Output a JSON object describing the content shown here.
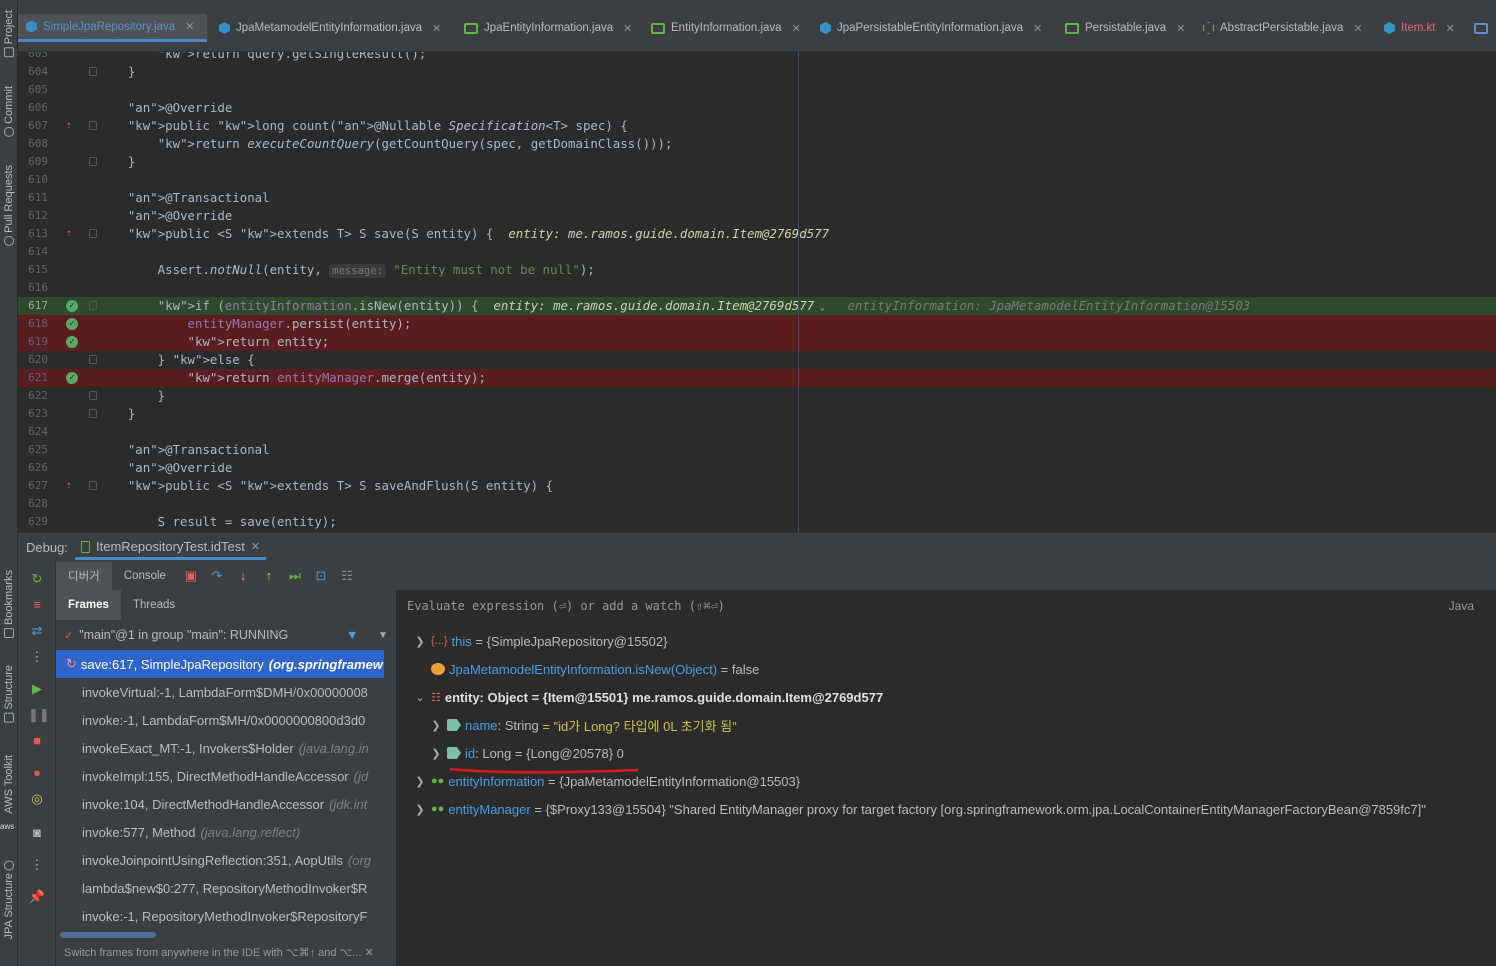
{
  "sidebar_left": {
    "top_items": [
      "Project",
      "Commit",
      "Pull Requests"
    ],
    "bottom_items": [
      "Bookmarks",
      "Structure",
      "AWS Toolkit",
      "JPA Structure"
    ],
    "aws_label": "aws"
  },
  "tabs": [
    {
      "label": "SimpleJpaRepository.java",
      "icon": "java-class-icon",
      "active": true
    },
    {
      "label": "JpaMetamodelEntityInformation.java",
      "icon": "java-class-icon"
    },
    {
      "label": "JpaEntityInformation.java",
      "icon": "interface-icon"
    },
    {
      "label": "EntityInformation.java",
      "icon": "interface-icon"
    },
    {
      "label": "JpaPersistableEntityInformation.java",
      "icon": "java-class-icon"
    },
    {
      "label": "Persistable.java",
      "icon": "interface-icon"
    },
    {
      "label": "AbstractPersistable.java",
      "icon": "abstract-class-icon"
    },
    {
      "label": "Item.kt",
      "icon": "kotlin-class-icon",
      "color": "#e06c6c"
    }
  ],
  "editor": {
    "lines": [
      {
        "n": "603",
        "code": "        return query.getSingleResult();"
      },
      {
        "n": "604",
        "code": "    }"
      },
      {
        "n": "605",
        "code": ""
      },
      {
        "n": "606",
        "code": "    @Override"
      },
      {
        "n": "607",
        "code": "    public long count(@Nullable Specification<T> spec) {"
      },
      {
        "n": "608",
        "code": "        return executeCountQuery(getCountQuery(spec, getDomainClass()));"
      },
      {
        "n": "609",
        "code": "    }"
      },
      {
        "n": "610",
        "code": ""
      },
      {
        "n": "611",
        "code": "    @Transactional"
      },
      {
        "n": "612",
        "code": "    @Override"
      },
      {
        "n": "613",
        "code": "    public <S extends T> S save(S entity) {",
        "inline": "entity: me.ramos.guide.domain.Item@2769d577"
      },
      {
        "n": "614",
        "code": ""
      },
      {
        "n": "615",
        "code": "        Assert.notNull(entity,",
        "hint": "message:",
        "rest": "\"Entity must not be null\");"
      },
      {
        "n": "616",
        "code": ""
      },
      {
        "n": "617",
        "code": "        if (entityInformation.isNew(entity)) {",
        "inline": "entity: me.ramos.guide.domain.Item@2769d577",
        "inline2": "entityInformation: JpaMetamodelEntityInformation@15503",
        "highlight": "green"
      },
      {
        "n": "618",
        "code": "            entityManager.persist(entity);",
        "highlight": "red"
      },
      {
        "n": "619",
        "code": "            return entity;",
        "highlight": "red"
      },
      {
        "n": "620",
        "code": "        } else {"
      },
      {
        "n": "621",
        "code": "            return entityManager.merge(entity);",
        "highlight": "red"
      },
      {
        "n": "622",
        "code": "        }"
      },
      {
        "n": "623",
        "code": "    }"
      },
      {
        "n": "624",
        "code": ""
      },
      {
        "n": "625",
        "code": "    @Transactional"
      },
      {
        "n": "626",
        "code": "    @Override"
      },
      {
        "n": "627",
        "code": "    public <S extends T> S saveAndFlush(S entity) {"
      },
      {
        "n": "628",
        "code": ""
      },
      {
        "n": "629",
        "code": "        S result = save(entity);"
      }
    ]
  },
  "debug": {
    "label": "Debug:",
    "session": "ItemRepositoryTest.idTest",
    "tab_debugger": "디버거",
    "tab_console": "Console",
    "subtab_frames": "Frames",
    "subtab_threads": "Threads",
    "thread": "\"main\"@1 in group \"main\": RUNNING",
    "frames": [
      {
        "method": "save:617, SimpleJpaRepository",
        "pkg": "(org.springframew",
        "selected": true
      },
      {
        "method": "invokeVirtual:-1, LambdaForm$DMH/0x00000008",
        "pkg": ""
      },
      {
        "method": "invoke:-1, LambdaForm$MH/0x0000000800d3d0",
        "pkg": ""
      },
      {
        "method": "invokeExact_MT:-1, Invokers$Holder",
        "pkg": "(java.lang.in"
      },
      {
        "method": "invokeImpl:155, DirectMethodHandleAccessor",
        "pkg": "(jd"
      },
      {
        "method": "invoke:104, DirectMethodHandleAccessor",
        "pkg": "(jdk.int"
      },
      {
        "method": "invoke:577, Method",
        "pkg": "(java.lang.reflect)"
      },
      {
        "method": "invokeJoinpointUsingReflection:351, AopUtils",
        "pkg": "(org"
      },
      {
        "method": "lambda$new$0:277, RepositoryMethodInvoker$R",
        "pkg": ""
      },
      {
        "method": "invoke:-1, RepositoryMethodInvoker$RepositoryF",
        "pkg": ""
      }
    ],
    "tip": "Switch frames from anywhere in the IDE with ⌥⌘↑ and ⌥...",
    "eval_placeholder": "Evaluate expression (⏎) or add a watch (⇧⌘⏎)",
    "eval_lang": "Java",
    "vars": {
      "this_name": "this",
      "this_val": "= {SimpleJpaRepository@15502}",
      "isnew_name": "JpaMetamodelEntityInformation.isNew(Object)",
      "isnew_val": "= false",
      "entity_name": "entity: Object",
      "entity_val": "= {Item@15501} me.ramos.guide.domain.Item@2769d577",
      "name_name": "name",
      "name_type": ": String",
      "name_val": "= \"id가 Long? 타입에 0L 초기화 됨\"",
      "id_name": "id",
      "id_type": ": Long",
      "id_val": "= {Long@20578} 0",
      "ei_name": "entityInformation",
      "ei_val": "= {JpaMetamodelEntityInformation@15503}",
      "em_name": "entityManager",
      "em_val": "= {$Proxy133@15504} \"Shared EntityManager proxy for target factory [org.springframework.orm.jpa.LocalContainerEntityManagerFactoryBean@7859fc7]\""
    }
  }
}
